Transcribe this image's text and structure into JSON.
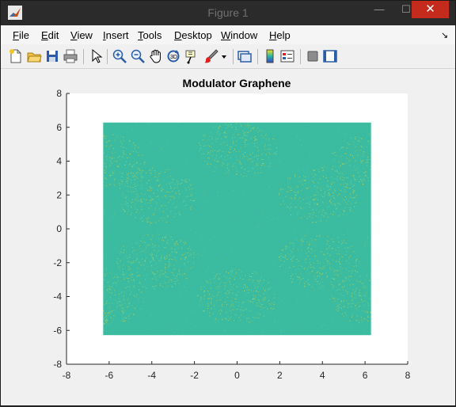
{
  "window": {
    "title": "Figure 1",
    "min_glyph": "—",
    "max_glyph": "☐",
    "close_glyph": "✕"
  },
  "menu": {
    "items": [
      {
        "label": "File",
        "mnemonic": "F",
        "rest": "ile"
      },
      {
        "label": "Edit",
        "mnemonic": "E",
        "rest": "dit"
      },
      {
        "label": "View",
        "mnemonic": "V",
        "rest": "iew"
      },
      {
        "label": "Insert",
        "mnemonic": "I",
        "rest": "nsert"
      },
      {
        "label": "Tools",
        "mnemonic": "T",
        "rest": "ools"
      },
      {
        "label": "Desktop",
        "mnemonic": "D",
        "rest": "esktop"
      },
      {
        "label": "Window",
        "mnemonic": "W",
        "rest": "indow"
      },
      {
        "label": "Help",
        "mnemonic": "H",
        "rest": "elp"
      }
    ],
    "dock_glyph": "↘"
  },
  "toolbar": {
    "icons": [
      "new-figure-icon",
      "open-file-icon",
      "save-icon",
      "print-icon",
      "edit-plot-arrow-icon",
      "zoom-in-icon",
      "zoom-out-icon",
      "pan-hand-icon",
      "rotate-3d-icon",
      "data-cursor-icon",
      "brush-icon",
      "brush-dropdown-icon",
      "link-plot-icon",
      "insert-colorbar-icon",
      "insert-legend-icon",
      "hide-plot-tools-icon",
      "show-plot-tools-icon"
    ]
  },
  "chart_data": {
    "type": "heatmap",
    "title": "Modulator Graphene",
    "xlabel": "",
    "ylabel": "",
    "xlim": [
      -8,
      8
    ],
    "ylim": [
      -8,
      8
    ],
    "xticks": [
      "-8",
      "-6",
      "-4",
      "-2",
      "0",
      "2",
      "4",
      "6",
      "8"
    ],
    "yticks": [
      "8",
      "6",
      "4",
      "2",
      "0",
      "-2",
      "-4",
      "-6",
      "-8"
    ],
    "data_extent": {
      "x": [
        -6.28,
        6.28
      ],
      "y": [
        -6.28,
        6.28
      ]
    },
    "colormap": "parula",
    "base_color": "#3bbca1",
    "speckle_color": "#c8d34a",
    "bright_blobs": [
      {
        "x": 0,
        "y": 4.7
      },
      {
        "x": -3.8,
        "y": 2.0
      },
      {
        "x": 3.8,
        "y": 2.0
      },
      {
        "x": -3.8,
        "y": -1.9
      },
      {
        "x": 3.8,
        "y": -1.9
      },
      {
        "x": 0,
        "y": -4.0
      },
      {
        "x": -6.2,
        "y": 4.0
      },
      {
        "x": 6.2,
        "y": 4.0
      },
      {
        "x": -6.2,
        "y": -4.0
      },
      {
        "x": 6.2,
        "y": -4.0
      }
    ],
    "grid": false,
    "legend": "none"
  }
}
